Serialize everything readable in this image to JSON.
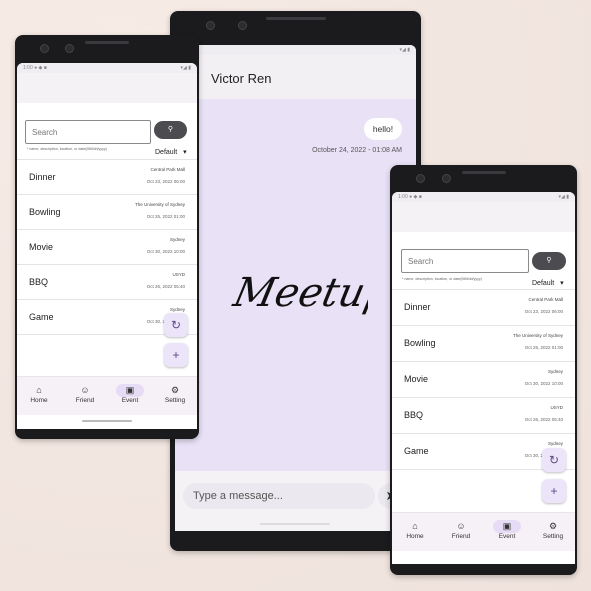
{
  "event_app": {
    "search": {
      "placeholder": "Search",
      "hint": "* name, description, location, or date(MM/dd/yyyy)",
      "sort": "Default"
    },
    "events": [
      {
        "name": "Dinner",
        "location": "Central Park Mall",
        "date": "Oct 23, 2022 06:00"
      },
      {
        "name": "Bowling",
        "location": "The University of Sydney",
        "date": "Oct 25, 2022 01:00"
      },
      {
        "name": "Movie",
        "location": "Sydney",
        "date": "Oct 30, 2022 10:00"
      },
      {
        "name": "BBQ",
        "location": "USYD",
        "date": "Oct 26, 2022 05:40"
      },
      {
        "name": "Game",
        "location": "Sydney",
        "date": "Oct 30, 2022 10:00"
      }
    ],
    "nav": [
      {
        "label": "Home",
        "icon": "home-icon"
      },
      {
        "label": "Friend",
        "icon": "person-icon"
      },
      {
        "label": "Event",
        "icon": "event-icon"
      },
      {
        "label": "Setting",
        "icon": "gear-icon"
      }
    ]
  },
  "chat": {
    "contact_name": "Victor Ren",
    "message": "hello!",
    "message_time": "October 24, 2022 - 01:08 AM",
    "input_placeholder": "Type a message..."
  },
  "brand": {
    "logo_text": "Meetup"
  },
  "colors": {
    "accent": "#e6dcf6",
    "chat_bg": "#e9e2f7",
    "button": "#4c4c50"
  }
}
